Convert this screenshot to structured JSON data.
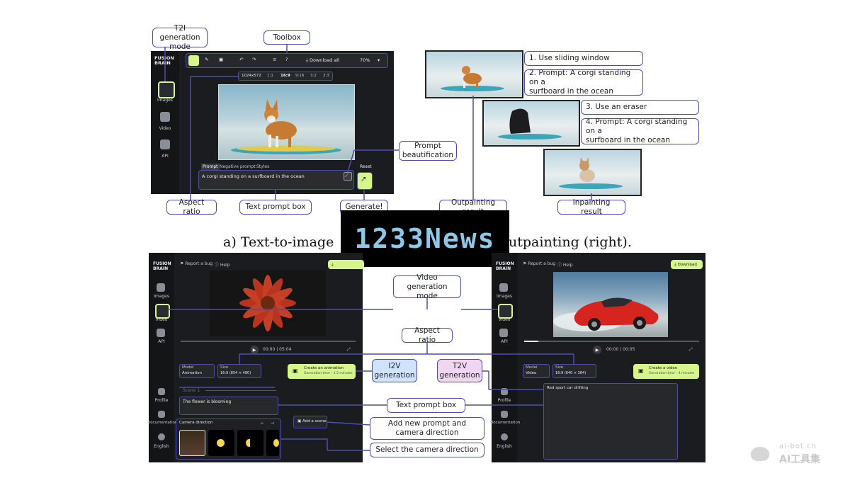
{
  "app": {
    "brand": "FUSION\nBRAIN",
    "nav": [
      "Images",
      "Video",
      "API"
    ],
    "nav_bottom": [
      "Profile",
      "Documentation",
      "English"
    ]
  },
  "t2i": {
    "toolbar": {
      "download_all": "Download all",
      "zoom": "70%"
    },
    "aspect_ratios": [
      "1024x572",
      "1:1",
      "16:9",
      "9:16",
      "3:2",
      "2:3"
    ],
    "prompt_tabs": [
      "Prompt",
      "Negative prompt",
      "Styles"
    ],
    "reset": "Reset",
    "prompt_text": "A corgi standing on a surfboard in the ocean"
  },
  "callouts_top": {
    "t2i_mode": "T2I generation\nmode",
    "toolbox": "Toolbox",
    "prompt_beautification": "Prompt\nbeautification",
    "aspect_ratio": "Aspect ratio",
    "text_prompt_box": "Text prompt box",
    "generate": "Generate!",
    "outpainting_result": "Outpainting result",
    "inpainting_result": "Inpainting result",
    "step1": "1. Use sliding window",
    "step2": "2. Prompt: A corgi standing on a\nsurfboard in the ocean",
    "step3": "3. Use an eraser",
    "step4": "4. Prompt: A corgi standing on a\nsurfboard in the ocean"
  },
  "caption_left": "a) Text-to-image",
  "caption_right": "utpainting (right).",
  "watermark": "1233News",
  "video": {
    "header": {
      "report_bug": "Report a bug",
      "help": "Help",
      "download": "Download"
    },
    "left": {
      "time": "00:00 | 05:04",
      "model_label": "Model",
      "model_value": "Animation",
      "size_label": "Size",
      "size_value": "16:9 (854 × 480)",
      "create_title": "Create an animation",
      "create_sub": "Generation time – 1,5 minutes",
      "scene_label": "Scene 1",
      "prompt_text": "The flower is blooming",
      "add_scene": "Add a scene",
      "camera_direction": "Camera direction"
    },
    "right": {
      "time": "00:00 | 00:05",
      "model_label": "Model",
      "model_value": "Video",
      "size_label": "Size",
      "size_value": "16:9 (640 × 384)",
      "create_title": "Create a video",
      "create_sub": "Generation time – 4 minutes",
      "prompt_text": "Red sport car drifting"
    }
  },
  "callouts_bottom": {
    "video_mode": "Video generation\nmode",
    "aspect_ratio": "Aspect ratio",
    "i2v": "I2V\ngeneration",
    "t2v": "T2V\ngeneration",
    "text_prompt_box": "Text prompt box",
    "add_prompt": "Add new prompt and\ncamera direction",
    "select_camera": "Select the camera direction"
  },
  "site_watermark": {
    "url": "ai-bot.cn",
    "name": "AI工具集"
  },
  "colors": {
    "accent": "#d7f58d",
    "callout_border": "#4b4fa8",
    "i2v_fill": "#cfe3ff",
    "t2v_fill": "#f1d6f4",
    "panel": "#1b1c1f"
  }
}
